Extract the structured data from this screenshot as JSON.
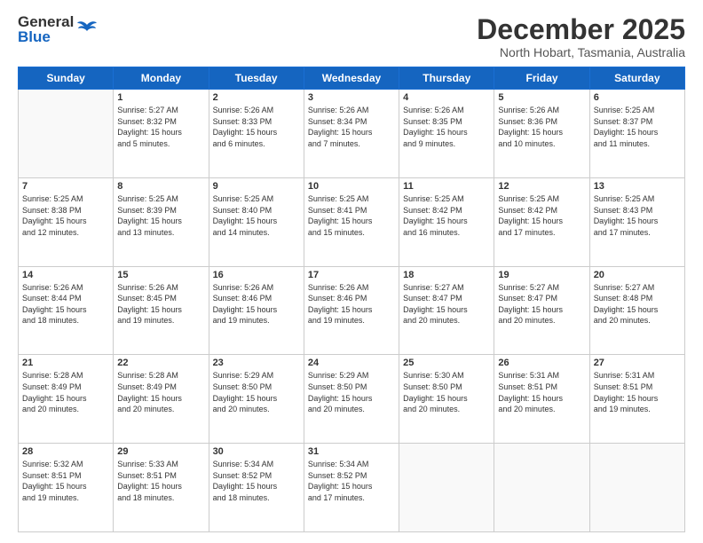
{
  "header": {
    "logo_general": "General",
    "logo_blue": "Blue",
    "month_title": "December 2025",
    "subtitle": "North Hobart, Tasmania, Australia"
  },
  "days_of_week": [
    "Sunday",
    "Monday",
    "Tuesday",
    "Wednesday",
    "Thursday",
    "Friday",
    "Saturday"
  ],
  "weeks": [
    [
      {
        "num": "",
        "info": ""
      },
      {
        "num": "1",
        "info": "Sunrise: 5:27 AM\nSunset: 8:32 PM\nDaylight: 15 hours\nand 5 minutes."
      },
      {
        "num": "2",
        "info": "Sunrise: 5:26 AM\nSunset: 8:33 PM\nDaylight: 15 hours\nand 6 minutes."
      },
      {
        "num": "3",
        "info": "Sunrise: 5:26 AM\nSunset: 8:34 PM\nDaylight: 15 hours\nand 7 minutes."
      },
      {
        "num": "4",
        "info": "Sunrise: 5:26 AM\nSunset: 8:35 PM\nDaylight: 15 hours\nand 9 minutes."
      },
      {
        "num": "5",
        "info": "Sunrise: 5:26 AM\nSunset: 8:36 PM\nDaylight: 15 hours\nand 10 minutes."
      },
      {
        "num": "6",
        "info": "Sunrise: 5:25 AM\nSunset: 8:37 PM\nDaylight: 15 hours\nand 11 minutes."
      }
    ],
    [
      {
        "num": "7",
        "info": "Sunrise: 5:25 AM\nSunset: 8:38 PM\nDaylight: 15 hours\nand 12 minutes."
      },
      {
        "num": "8",
        "info": "Sunrise: 5:25 AM\nSunset: 8:39 PM\nDaylight: 15 hours\nand 13 minutes."
      },
      {
        "num": "9",
        "info": "Sunrise: 5:25 AM\nSunset: 8:40 PM\nDaylight: 15 hours\nand 14 minutes."
      },
      {
        "num": "10",
        "info": "Sunrise: 5:25 AM\nSunset: 8:41 PM\nDaylight: 15 hours\nand 15 minutes."
      },
      {
        "num": "11",
        "info": "Sunrise: 5:25 AM\nSunset: 8:42 PM\nDaylight: 15 hours\nand 16 minutes."
      },
      {
        "num": "12",
        "info": "Sunrise: 5:25 AM\nSunset: 8:42 PM\nDaylight: 15 hours\nand 17 minutes."
      },
      {
        "num": "13",
        "info": "Sunrise: 5:25 AM\nSunset: 8:43 PM\nDaylight: 15 hours\nand 17 minutes."
      }
    ],
    [
      {
        "num": "14",
        "info": "Sunrise: 5:26 AM\nSunset: 8:44 PM\nDaylight: 15 hours\nand 18 minutes."
      },
      {
        "num": "15",
        "info": "Sunrise: 5:26 AM\nSunset: 8:45 PM\nDaylight: 15 hours\nand 19 minutes."
      },
      {
        "num": "16",
        "info": "Sunrise: 5:26 AM\nSunset: 8:46 PM\nDaylight: 15 hours\nand 19 minutes."
      },
      {
        "num": "17",
        "info": "Sunrise: 5:26 AM\nSunset: 8:46 PM\nDaylight: 15 hours\nand 19 minutes."
      },
      {
        "num": "18",
        "info": "Sunrise: 5:27 AM\nSunset: 8:47 PM\nDaylight: 15 hours\nand 20 minutes."
      },
      {
        "num": "19",
        "info": "Sunrise: 5:27 AM\nSunset: 8:47 PM\nDaylight: 15 hours\nand 20 minutes."
      },
      {
        "num": "20",
        "info": "Sunrise: 5:27 AM\nSunset: 8:48 PM\nDaylight: 15 hours\nand 20 minutes."
      }
    ],
    [
      {
        "num": "21",
        "info": "Sunrise: 5:28 AM\nSunset: 8:49 PM\nDaylight: 15 hours\nand 20 minutes."
      },
      {
        "num": "22",
        "info": "Sunrise: 5:28 AM\nSunset: 8:49 PM\nDaylight: 15 hours\nand 20 minutes."
      },
      {
        "num": "23",
        "info": "Sunrise: 5:29 AM\nSunset: 8:50 PM\nDaylight: 15 hours\nand 20 minutes."
      },
      {
        "num": "24",
        "info": "Sunrise: 5:29 AM\nSunset: 8:50 PM\nDaylight: 15 hours\nand 20 minutes."
      },
      {
        "num": "25",
        "info": "Sunrise: 5:30 AM\nSunset: 8:50 PM\nDaylight: 15 hours\nand 20 minutes."
      },
      {
        "num": "26",
        "info": "Sunrise: 5:31 AM\nSunset: 8:51 PM\nDaylight: 15 hours\nand 20 minutes."
      },
      {
        "num": "27",
        "info": "Sunrise: 5:31 AM\nSunset: 8:51 PM\nDaylight: 15 hours\nand 19 minutes."
      }
    ],
    [
      {
        "num": "28",
        "info": "Sunrise: 5:32 AM\nSunset: 8:51 PM\nDaylight: 15 hours\nand 19 minutes."
      },
      {
        "num": "29",
        "info": "Sunrise: 5:33 AM\nSunset: 8:51 PM\nDaylight: 15 hours\nand 18 minutes."
      },
      {
        "num": "30",
        "info": "Sunrise: 5:34 AM\nSunset: 8:52 PM\nDaylight: 15 hours\nand 18 minutes."
      },
      {
        "num": "31",
        "info": "Sunrise: 5:34 AM\nSunset: 8:52 PM\nDaylight: 15 hours\nand 17 minutes."
      },
      {
        "num": "",
        "info": ""
      },
      {
        "num": "",
        "info": ""
      },
      {
        "num": "",
        "info": ""
      }
    ]
  ]
}
